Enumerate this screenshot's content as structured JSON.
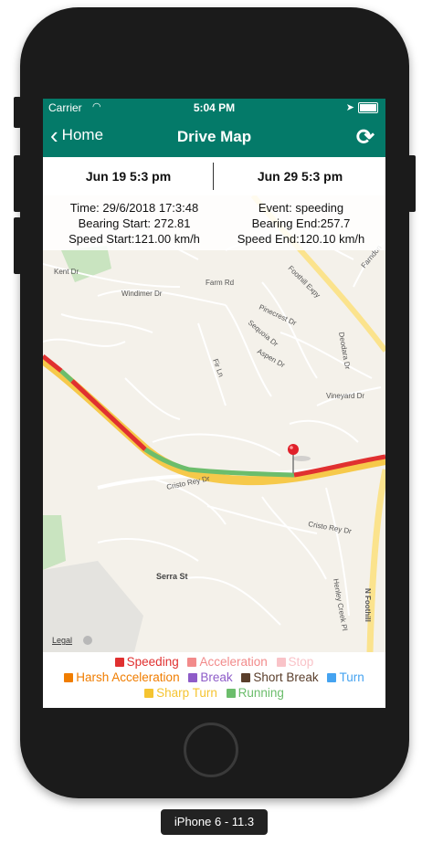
{
  "status_bar": {
    "carrier": "Carrier",
    "time": "5:04 PM"
  },
  "nav": {
    "back_label": "Home",
    "title": "Drive Map",
    "refresh_icon": "refresh-icon"
  },
  "dates": {
    "start": "Jun 19 5:3 pm",
    "end": "Jun 29 5:3 pm"
  },
  "event_info": {
    "time": "Time: 29/6/2018 17:3:48",
    "event": "Event: speeding",
    "bearing_start": "Bearing Start: 272.81",
    "bearing_end": "Bearing End:257.7",
    "speed_start": "Speed Start:121.00 km/h",
    "speed_end": "Speed End:120.10 km/h"
  },
  "map": {
    "labels": {
      "kent": "Kent Dr",
      "windimer": "Windimer Dr",
      "farm": "Farm Rd",
      "foothill_expy": "Foothill Expy",
      "pinecrest": "Pinecrest Dr",
      "sequoia": "Sequoia Dr",
      "aspen": "Aspen Dr",
      "fir": "Fir Ln",
      "deodara": "Deodara Dr",
      "vineyard": "Vineyard Dr",
      "cristo_rey_1": "Cristo Rey Dr",
      "cristo_rey_2": "Cristo Rey Dr",
      "serra": "Serra St",
      "henley": "Henley Creek Pl",
      "n_foothill": "N Foothill",
      "farndon": "Farndon",
      "legal": "Legal"
    }
  },
  "legend": {
    "speeding": "Speeding",
    "acceleration": "Acceleration",
    "stop": "Stop",
    "harsh_acceleration": "Harsh Acceleration",
    "break": "Break",
    "short_break": "Short Break",
    "turn": "Turn",
    "sharp_turn": "Sharp Turn",
    "running": "Running",
    "colors": {
      "speeding": "#e03030",
      "acceleration": "#f28b8b",
      "stop": "#f9c3c8",
      "harsh_acceleration": "#f07d00",
      "break": "#8e5cc8",
      "short_break": "#5a3e2b",
      "turn": "#45a3f0",
      "sharp_turn": "#f5c431",
      "running": "#6cbd6c"
    }
  },
  "device_label": "iPhone 6 - 11.3"
}
